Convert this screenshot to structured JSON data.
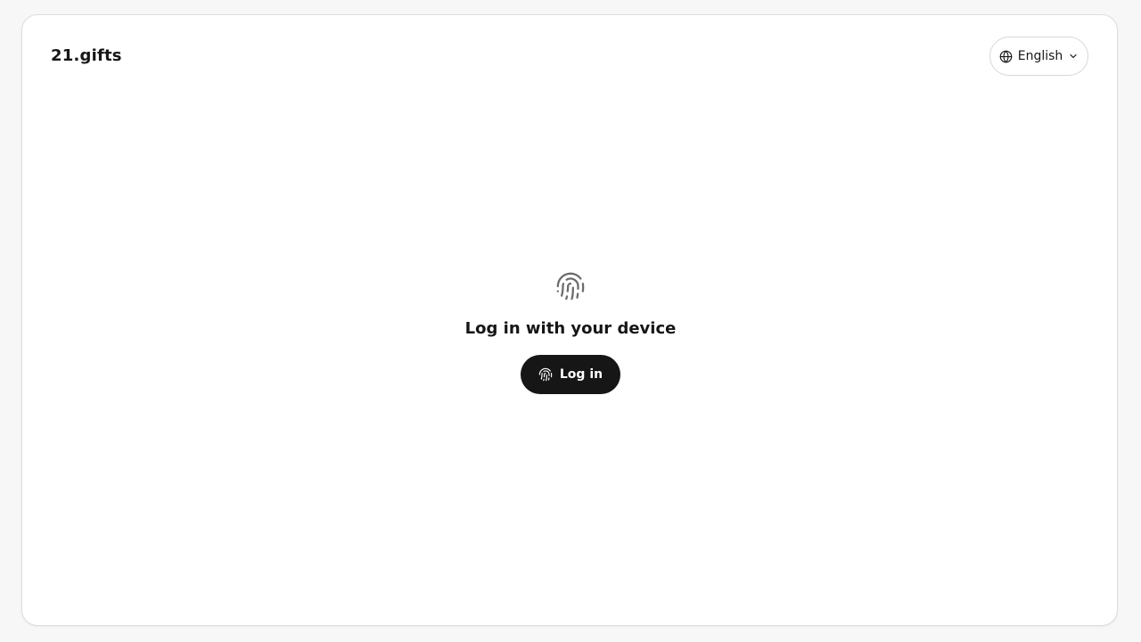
{
  "header": {
    "logo": "21.gifts",
    "language": {
      "label": "English",
      "icon": "globe-icon",
      "chevron_icon": "chevron-down-icon"
    }
  },
  "main": {
    "icon": "fingerprint-icon",
    "heading": "Log in with your device",
    "login_button": {
      "label": "Log in",
      "icon": "fingerprint-icon"
    }
  },
  "colors": {
    "button_bg": "#161616",
    "button_text": "#ffffff",
    "text": "#161616",
    "icon_gray": "#6b6b6b",
    "border": "#d7d7d7"
  }
}
